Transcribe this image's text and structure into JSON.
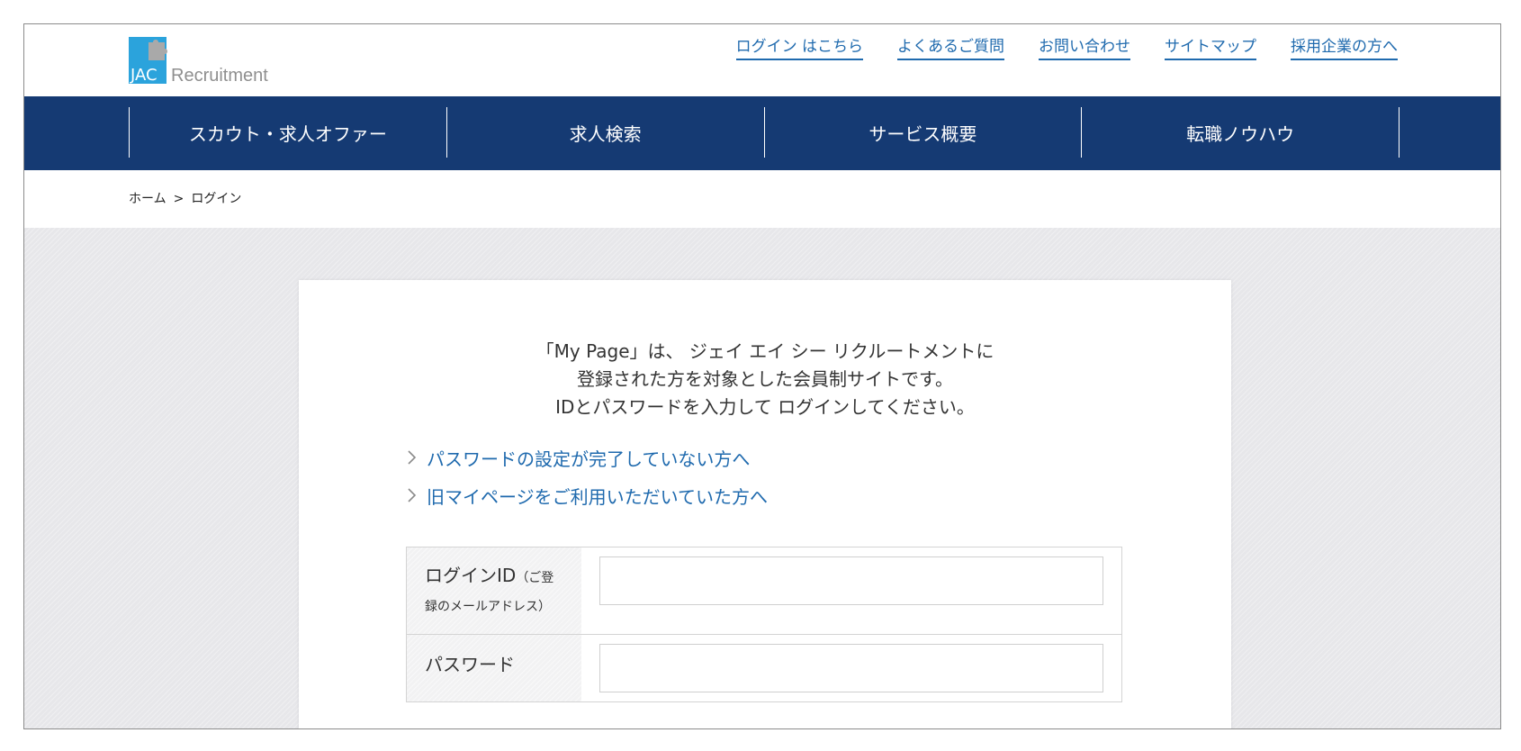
{
  "logo": {
    "mark_text": "JAC",
    "wordmark": "Recruitment",
    "colors": {
      "square": "#2ba3dc",
      "puzzle": "#a9a9a9",
      "wordmark": "#8f8f8f"
    }
  },
  "header": {
    "links": [
      {
        "label": "ログイン はこちら"
      },
      {
        "label": "よくあるご質問"
      },
      {
        "label": "お問い合わせ"
      },
      {
        "label": "サイトマップ"
      },
      {
        "label": "採用企業の方へ"
      }
    ]
  },
  "nav": {
    "items": [
      {
        "label": "スカウト・求人オファー"
      },
      {
        "label": "求人検索"
      },
      {
        "label": "サービス概要"
      },
      {
        "label": "転職ノウハウ"
      }
    ],
    "color": "#153a73"
  },
  "breadcrumb": {
    "home": "ホーム",
    "separator": ">",
    "current": "ログイン"
  },
  "login": {
    "intro_lines": [
      "「My Page」は、 ジェイ エイ シー リクルートメントに",
      "登録された方を対象とした会員制サイトです。",
      "IDとパスワードを入力して ログインしてください。"
    ],
    "links": [
      {
        "label": "パスワードの設定が完了していない方へ",
        "icon": "chevron-right-icon"
      },
      {
        "label": "旧マイページをご利用いただいていた方へ",
        "icon": "chevron-right-icon"
      }
    ],
    "fields": {
      "login_id": {
        "label": "ログインID",
        "note_line1": "（ご登",
        "note_line2": "録のメールアドレス）",
        "value": "",
        "placeholder": ""
      },
      "password": {
        "label": "パスワード",
        "value": "",
        "placeholder": ""
      }
    },
    "link_color": "#1f6aae"
  }
}
